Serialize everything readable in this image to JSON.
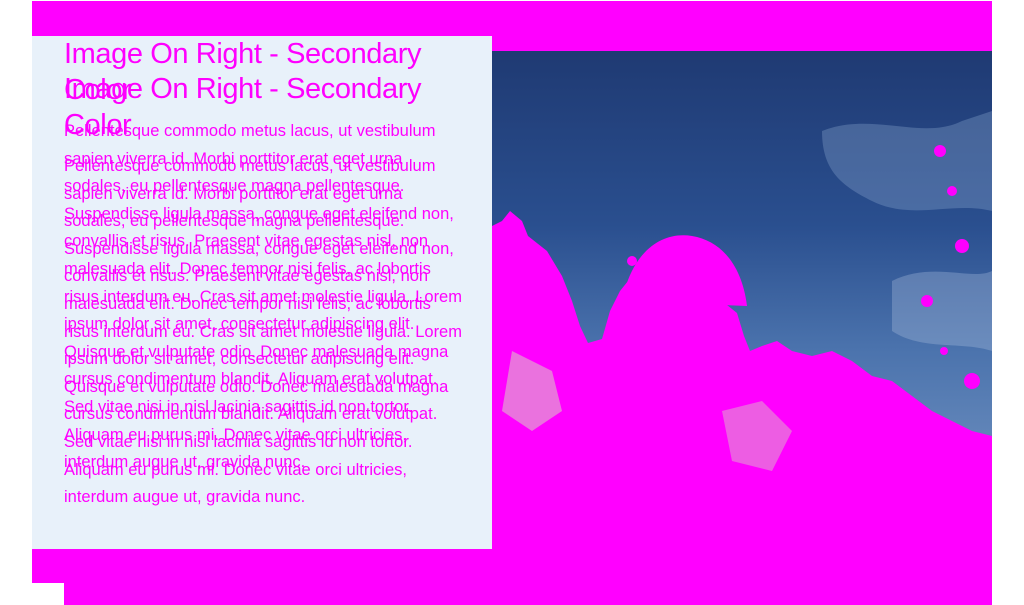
{
  "card": {
    "title": "Image On Right - Secondary Color",
    "body": "Pellentesque commodo metus lacus, ut vestibulum sapien viverra id. Morbi porttitor erat eget urna sodales, eu pellentesque magna pellentesque. Suspendisse ligula massa, congue eget eleifend non, convallis et risus. Praesent vitae egestas nisl, non malesuada elit. Donec tempor nisi felis, ac lobortis risus interdum eu. Cras sit amet molestie ligula. Lorem ipsum dolor sit amet, consectetur adipiscing elit. Quisque et vulputate odio. Donec malesuada magna cursus condimentum blandit. Aliquam erat volutpat. Sed vitae nisi in nisl lacinia sagittis id non tortor. Aliquam eu purus mi. Donec vitae orci ultricies, interdum augue ut, gravida nunc."
  },
  "image": {
    "subject": "building-dome-against-blue-sky"
  },
  "colors": {
    "accent": "#ff00ff",
    "card_background": "#e8f1fa",
    "sky_top": "#1f3a73",
    "sky_bottom": "#7d9cc7"
  }
}
